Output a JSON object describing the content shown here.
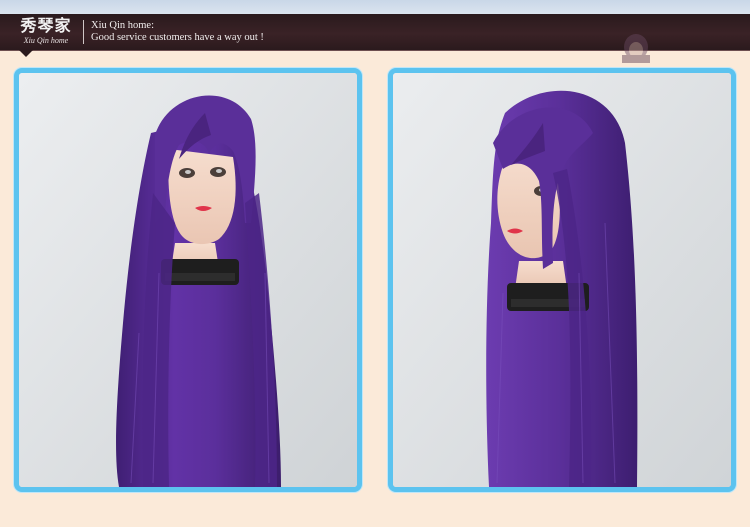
{
  "header": {
    "logo_cn": "秀琴家",
    "logo_en": "Xiu Qin home",
    "title": "Xiu Qin home:",
    "tagline": "Good service customers have a way out !"
  },
  "colors": {
    "frame_border": "#5cc3ef",
    "header_bg": "#2b1a1d",
    "page_bg": "#fbead9",
    "wig_purple": "#5a2f99"
  },
  "photos": [
    {
      "name": "wig-front-view",
      "icon": "mannequin-head-front"
    },
    {
      "name": "wig-side-view",
      "icon": "mannequin-head-side"
    }
  ]
}
